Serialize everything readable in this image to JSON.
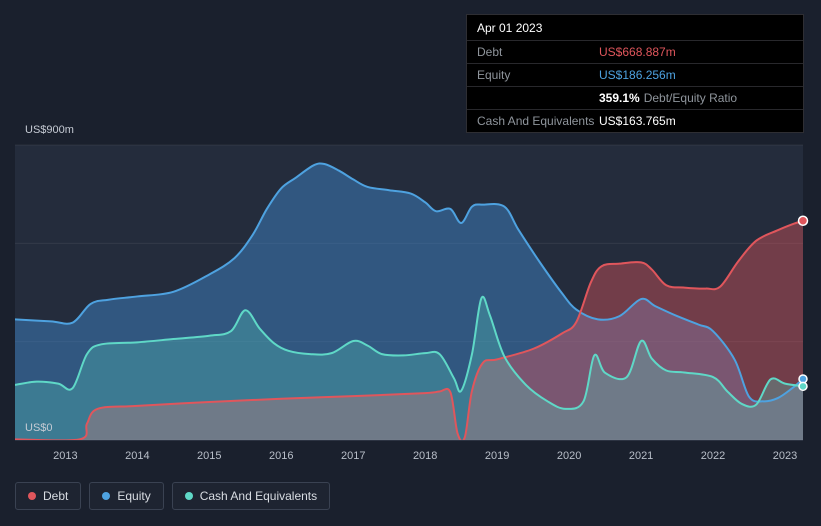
{
  "tooltip": {
    "date": "Apr 01 2023",
    "debt_label": "Debt",
    "debt_value": "US$668.887m",
    "debt_color": "#e0565c",
    "equity_label": "Equity",
    "equity_value": "US$186.256m",
    "equity_color": "#4ea2e0",
    "ratio_value": "359.1%",
    "ratio_label": "Debt/Equity Ratio",
    "cash_label": "Cash And Equivalents",
    "cash_value": "US$163.765m",
    "cash_color": "#ffffff"
  },
  "axis": {
    "y_top": "US$900m",
    "y_bottom": "US$0"
  },
  "legend": [
    {
      "label": "Debt",
      "color": "#e0565c"
    },
    {
      "label": "Equity",
      "color": "#4ea2e0"
    },
    {
      "label": "Cash And Equivalents",
      "color": "#5fd8c7"
    }
  ],
  "chart_data": {
    "type": "area",
    "x_range": [
      2012.3,
      2023.25
    ],
    "ylim": [
      0,
      900
    ],
    "y_gridlines": [
      0,
      300,
      600,
      900
    ],
    "x_ticks": [
      "2013",
      "2014",
      "2015",
      "2016",
      "2017",
      "2018",
      "2019",
      "2020",
      "2021",
      "2022",
      "2023"
    ],
    "legend_position": "bottom-left",
    "grid": true,
    "series": [
      {
        "name": "Debt",
        "color": "#e0565c",
        "fill": "rgba(224,86,92,0.42)",
        "points": [
          [
            2012.3,
            2
          ],
          [
            2013.2,
            2
          ],
          [
            2013.3,
            50
          ],
          [
            2013.45,
            95
          ],
          [
            2014,
            104
          ],
          [
            2015,
            116
          ],
          [
            2016,
            126
          ],
          [
            2017,
            134
          ],
          [
            2018,
            143
          ],
          [
            2018.2,
            148
          ],
          [
            2018.35,
            146
          ],
          [
            2018.45,
            20
          ],
          [
            2018.55,
            8
          ],
          [
            2018.65,
            150
          ],
          [
            2018.8,
            235
          ],
          [
            2019,
            246
          ],
          [
            2019.5,
            278
          ],
          [
            2019.9,
            325
          ],
          [
            2020.1,
            360
          ],
          [
            2020.3,
            480
          ],
          [
            2020.45,
            530
          ],
          [
            2020.7,
            538
          ],
          [
            2021,
            542
          ],
          [
            2021.15,
            520
          ],
          [
            2021.35,
            472
          ],
          [
            2021.6,
            465
          ],
          [
            2021.9,
            462
          ],
          [
            2022.1,
            468
          ],
          [
            2022.35,
            545
          ],
          [
            2022.6,
            608
          ],
          [
            2022.9,
            640
          ],
          [
            2023.1,
            658
          ],
          [
            2023.25,
            668.887
          ]
        ]
      },
      {
        "name": "Equity",
        "color": "#4ea2e0",
        "fill": "rgba(66,140,210,0.45)",
        "points": [
          [
            2012.3,
            368
          ],
          [
            2012.8,
            362
          ],
          [
            2013.1,
            358
          ],
          [
            2013.35,
            415
          ],
          [
            2013.6,
            428
          ],
          [
            2014,
            438
          ],
          [
            2014.5,
            452
          ],
          [
            2015,
            505
          ],
          [
            2015.35,
            555
          ],
          [
            2015.6,
            625
          ],
          [
            2015.8,
            705
          ],
          [
            2016,
            768
          ],
          [
            2016.2,
            800
          ],
          [
            2016.45,
            838
          ],
          [
            2016.6,
            842
          ],
          [
            2016.8,
            822
          ],
          [
            2017,
            795
          ],
          [
            2017.2,
            772
          ],
          [
            2017.5,
            762
          ],
          [
            2017.8,
            752
          ],
          [
            2018,
            725
          ],
          [
            2018.15,
            698
          ],
          [
            2018.35,
            705
          ],
          [
            2018.5,
            662
          ],
          [
            2018.65,
            712
          ],
          [
            2018.8,
            718
          ],
          [
            2019.1,
            712
          ],
          [
            2019.3,
            640
          ],
          [
            2019.6,
            540
          ],
          [
            2019.9,
            448
          ],
          [
            2020.1,
            398
          ],
          [
            2020.4,
            368
          ],
          [
            2020.7,
            378
          ],
          [
            2021,
            430
          ],
          [
            2021.2,
            408
          ],
          [
            2021.5,
            378
          ],
          [
            2021.8,
            352
          ],
          [
            2022,
            332
          ],
          [
            2022.3,
            245
          ],
          [
            2022.5,
            132
          ],
          [
            2022.7,
            118
          ],
          [
            2022.9,
            128
          ],
          [
            2023.1,
            158
          ],
          [
            2023.25,
            186.256
          ]
        ]
      },
      {
        "name": "Cash And Equivalents",
        "color": "#5fd8c7",
        "fill": "rgba(85,205,190,0.30)",
        "points": [
          [
            2012.3,
            168
          ],
          [
            2012.6,
            178
          ],
          [
            2012.9,
            172
          ],
          [
            2013.1,
            158
          ],
          [
            2013.3,
            262
          ],
          [
            2013.5,
            292
          ],
          [
            2014,
            298
          ],
          [
            2014.5,
            308
          ],
          [
            2015,
            318
          ],
          [
            2015.3,
            332
          ],
          [
            2015.5,
            396
          ],
          [
            2015.7,
            340
          ],
          [
            2015.9,
            295
          ],
          [
            2016.1,
            272
          ],
          [
            2016.4,
            262
          ],
          [
            2016.7,
            265
          ],
          [
            2017,
            302
          ],
          [
            2017.2,
            288
          ],
          [
            2017.4,
            262
          ],
          [
            2017.7,
            258
          ],
          [
            2018,
            265
          ],
          [
            2018.2,
            262
          ],
          [
            2018.4,
            188
          ],
          [
            2018.5,
            150
          ],
          [
            2018.65,
            262
          ],
          [
            2018.78,
            432
          ],
          [
            2018.9,
            380
          ],
          [
            2019.1,
            255
          ],
          [
            2019.4,
            168
          ],
          [
            2019.7,
            118
          ],
          [
            2019.95,
            95
          ],
          [
            2020.2,
            118
          ],
          [
            2020.35,
            258
          ],
          [
            2020.5,
            205
          ],
          [
            2020.8,
            192
          ],
          [
            2021,
            302
          ],
          [
            2021.15,
            248
          ],
          [
            2021.35,
            212
          ],
          [
            2021.6,
            206
          ],
          [
            2022,
            192
          ],
          [
            2022.2,
            148
          ],
          [
            2022.4,
            110
          ],
          [
            2022.6,
            108
          ],
          [
            2022.8,
            185
          ],
          [
            2023,
            172
          ],
          [
            2023.25,
            163.765
          ]
        ]
      }
    ]
  }
}
